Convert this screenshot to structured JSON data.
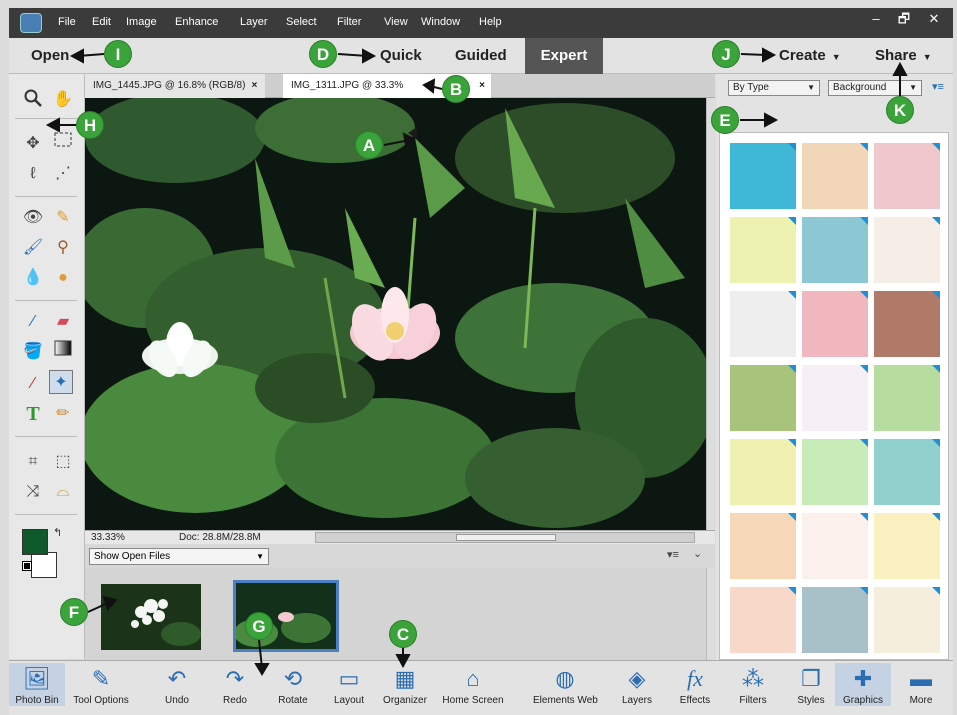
{
  "menubar": {
    "items": [
      "File",
      "Edit",
      "Image",
      "Enhance",
      "Layer",
      "Select",
      "Filter",
      "View",
      "Window",
      "Help"
    ],
    "window_buttons": [
      "–",
      "🗗",
      "✕"
    ]
  },
  "modebar": {
    "open": "Open",
    "quick": "Quick",
    "guided": "Guided",
    "expert": "Expert",
    "create": "Create",
    "share": "Share"
  },
  "doc_tabs": [
    {
      "label": "IMG_1445.JPG @ 16.8% (RGB/8)",
      "close": "×"
    },
    {
      "label": "IMG_1311.JPG @ 33.3%",
      "close": "×"
    }
  ],
  "status": {
    "zoom": "33.33%",
    "doc": "Doc: 28.8M/28.8M"
  },
  "photo_bin": {
    "select": "Show Open Files"
  },
  "right_panel": {
    "filter_type": "By Type",
    "filter_category": "Background"
  },
  "bottom_bar": [
    {
      "label": "Photo Bin",
      "icon": "photo-bin-icon"
    },
    {
      "label": "Tool Options",
      "icon": "tool-options-icon"
    },
    {
      "label": "Undo",
      "icon": "undo-icon"
    },
    {
      "label": "Redo",
      "icon": "redo-icon"
    },
    {
      "label": "Rotate",
      "icon": "rotate-icon"
    },
    {
      "label": "Layout",
      "icon": "layout-icon"
    },
    {
      "label": "Organizer",
      "icon": "organizer-icon"
    },
    {
      "label": "Home Screen",
      "icon": "home-icon"
    },
    {
      "label": "Elements Web",
      "icon": "globe-icon"
    },
    {
      "label": "Layers",
      "icon": "layers-icon"
    },
    {
      "label": "Effects",
      "icon": "fx-icon"
    },
    {
      "label": "Filters",
      "icon": "filters-icon"
    },
    {
      "label": "Styles",
      "icon": "styles-icon"
    },
    {
      "label": "Graphics",
      "icon": "graphics-icon"
    },
    {
      "label": "More",
      "icon": "more-icon"
    }
  ],
  "callouts": [
    "A",
    "B",
    "C",
    "D",
    "E",
    "F",
    "G",
    "H",
    "I",
    "J",
    "K"
  ],
  "colors": {
    "accent": "#3aa33a",
    "menubar": "#3b3b3b",
    "foreground": "#0f5a2a",
    "background": "#ffffff"
  }
}
